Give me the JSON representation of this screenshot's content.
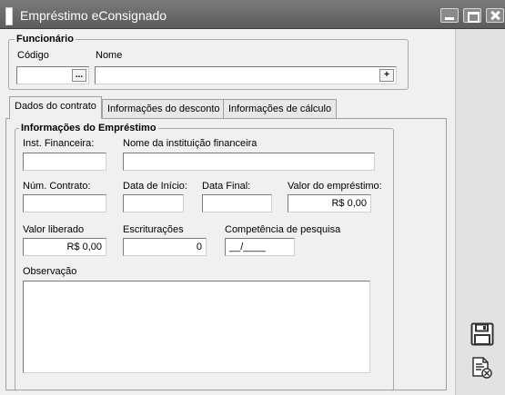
{
  "window": {
    "title": "Empréstimo eConsignado"
  },
  "funcionario": {
    "group_title": "Funcionário",
    "codigo_label": "Código",
    "codigo_value": "",
    "nome_label": "Nome",
    "nome_value": "",
    "lookup_label": "...",
    "add_label": "+"
  },
  "tabs": [
    {
      "label": "Dados do contrato",
      "active": true
    },
    {
      "label": "Informações do desconto",
      "active": false
    },
    {
      "label": "Informações de cálculo",
      "active": false
    }
  ],
  "emprestimo": {
    "group_title": "Informações do Empréstimo",
    "inst_financeira_label": "Inst. Financeira:",
    "inst_financeira_value": "",
    "nome_instituicao_label": "Nome da instituição financeira",
    "nome_instituicao_value": "",
    "num_contrato_label": "Núm. Contrato:",
    "num_contrato_value": "",
    "data_inicio_label": "Data de Início:",
    "data_inicio_value": "",
    "data_final_label": "Data Final:",
    "data_final_value": "",
    "valor_emprestimo_label": "Valor do empréstimo:",
    "valor_emprestimo_value": "R$ 0,00",
    "valor_liberado_label": "Valor liberado",
    "valor_liberado_value": "R$ 0,00",
    "escrituracoes_label": "Escriturações",
    "escrituracoes_value": "0",
    "competencia_label": "Competência de pesquisa",
    "competencia_value": "__/____",
    "observacao_label": "Observação",
    "observacao_value": ""
  },
  "sidebar": {
    "save_icon": "floppy-disk-icon",
    "cancel_icon": "document-cancel-icon"
  }
}
